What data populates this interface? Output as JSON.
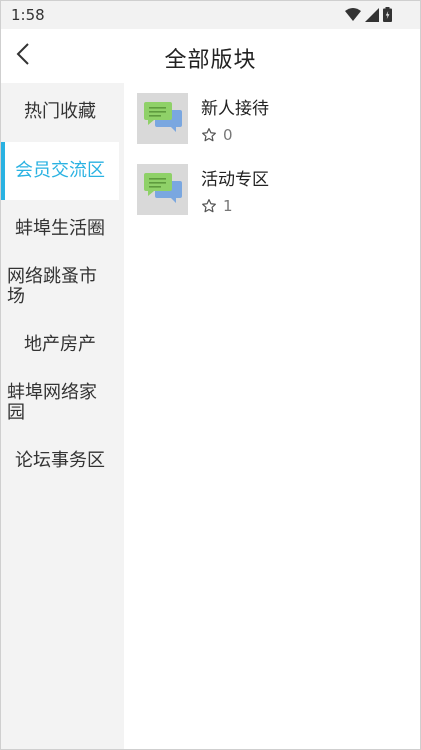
{
  "status_bar": {
    "time": "1:58",
    "icons": [
      "wifi-icon",
      "signal-icon",
      "battery-icon"
    ]
  },
  "header": {
    "title": "全部版块",
    "back_icon": "chevron-left-icon"
  },
  "sidebar": {
    "accent_color": "#2ab2e2",
    "items": [
      {
        "label": "热门收藏",
        "active": false
      },
      {
        "label": "会员交流区",
        "active": true
      },
      {
        "label": "蚌埠生活圈",
        "active": false
      },
      {
        "label": "网络跳蚤市场",
        "active": false
      },
      {
        "label": "地产房产",
        "active": false
      },
      {
        "label": "蚌埠网络家园",
        "active": false
      },
      {
        "label": "论坛事务区",
        "active": false
      }
    ]
  },
  "forums": [
    {
      "name": "新人接待",
      "favorites": "0",
      "icon": "chat-bubbles-icon"
    },
    {
      "name": "活动专区",
      "favorites": "1",
      "icon": "chat-bubbles-icon"
    }
  ]
}
